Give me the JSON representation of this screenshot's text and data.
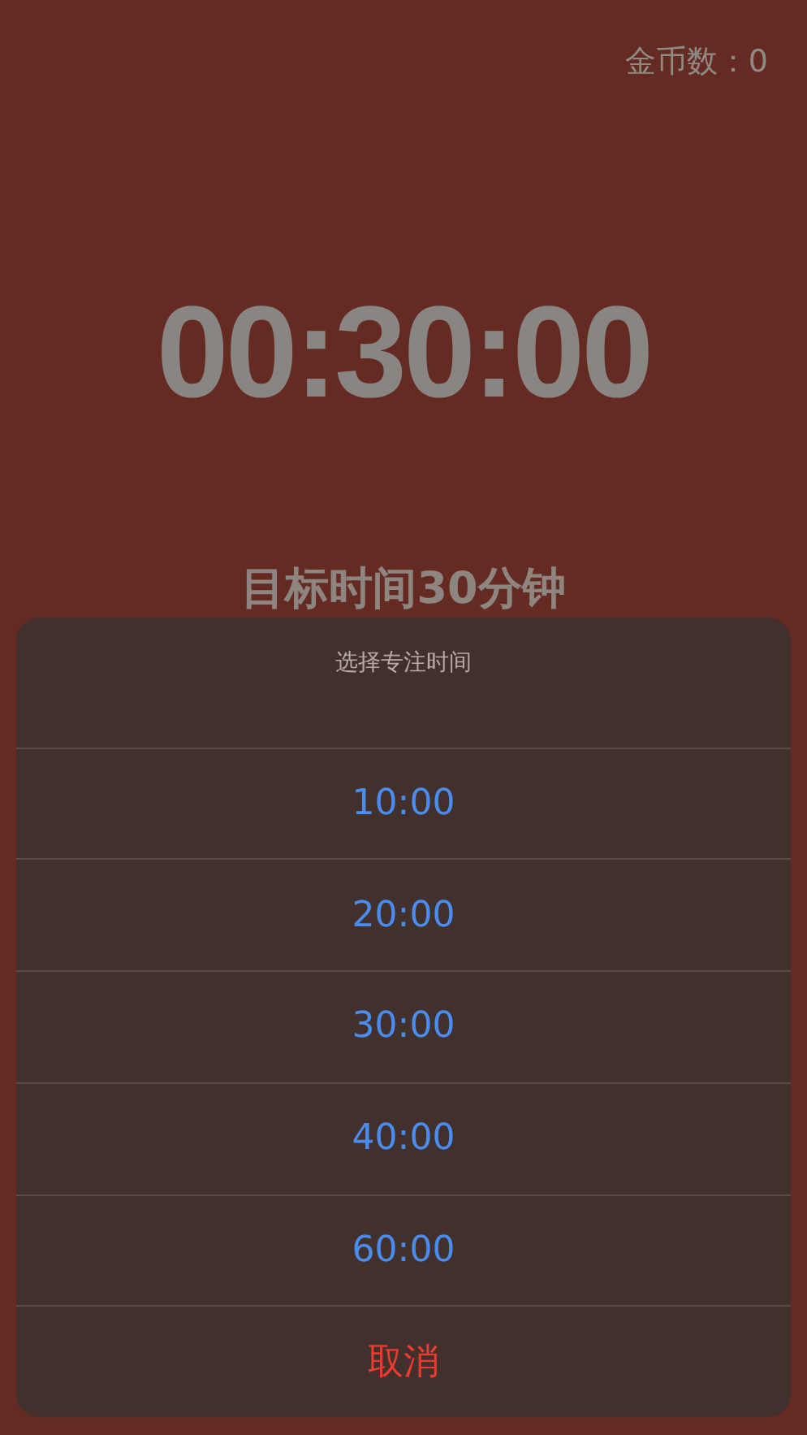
{
  "coins": {
    "label": "金币数：",
    "value": "0"
  },
  "timer": "00:30:00",
  "target": "目标时间30分钟",
  "sheet": {
    "title": "选择专注时间",
    "options": [
      {
        "label": "10:00"
      },
      {
        "label": "20:00"
      },
      {
        "label": "30:00"
      },
      {
        "label": "40:00"
      },
      {
        "label": "60:00"
      }
    ],
    "cancel": "取消"
  }
}
